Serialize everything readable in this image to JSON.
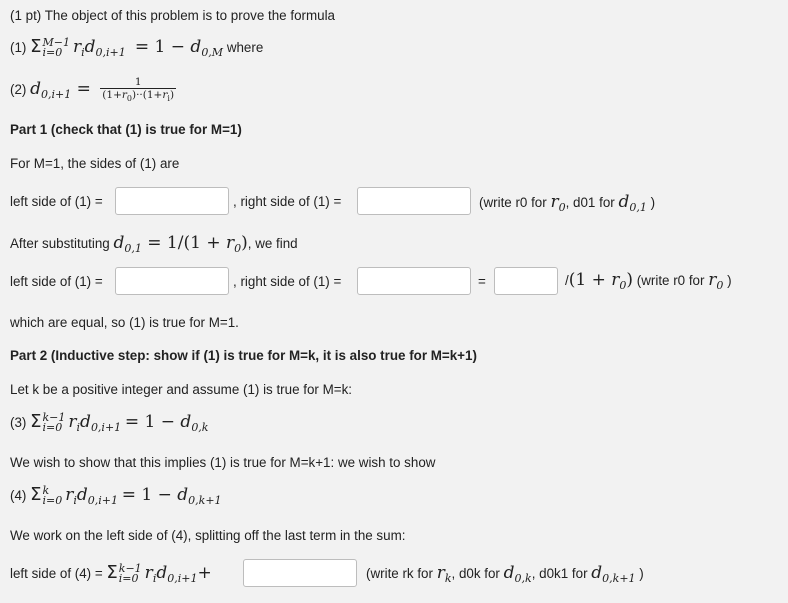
{
  "intro": "(1 pt) The object of this problem is to prove the formula",
  "eq1_label": "(1)",
  "eq1_where": "where",
  "eq2_label": "(2)",
  "part1_title": "Part 1 (check that (1) is true for M=1)",
  "part1_sides": "For M=1, the sides of (1) are",
  "left_side_1": "left side of (1) =",
  "right_side_1": ", right side of (1) =",
  "write_note_1": "(write r0 for",
  "write_note_1b": ", d01 for",
  "after_sub_pre": "After substituting",
  "after_sub_post": ", we find",
  "left_side_1b": "left side of (1) =",
  "right_side_1b": ", right side of (1) =",
  "equals": "=",
  "slash": "/",
  "write_note_2": "(write r0 for",
  "which_equal": "which are equal, so (1) is true for M=1.",
  "part2_title": "Part 2 (Inductive step: show if (1) is true for M=k, it is also true for M=k+1)",
  "let_k": "Let k be a positive integer and assume (1) is true for M=k:",
  "eq3_label": "(3)",
  "wish_show": "We wish to show that this implies (1) is true for M=k+1: we wish to show",
  "eq4_label": "(4)",
  "work_left": "We work on the left side of (4), splitting off the last term in the sum:",
  "left_side_4": "left side of (4) =",
  "write_note_3": "(write rk for",
  "write_note_3b": ", d0k for",
  "write_note_3c": ", d0k1 for"
}
